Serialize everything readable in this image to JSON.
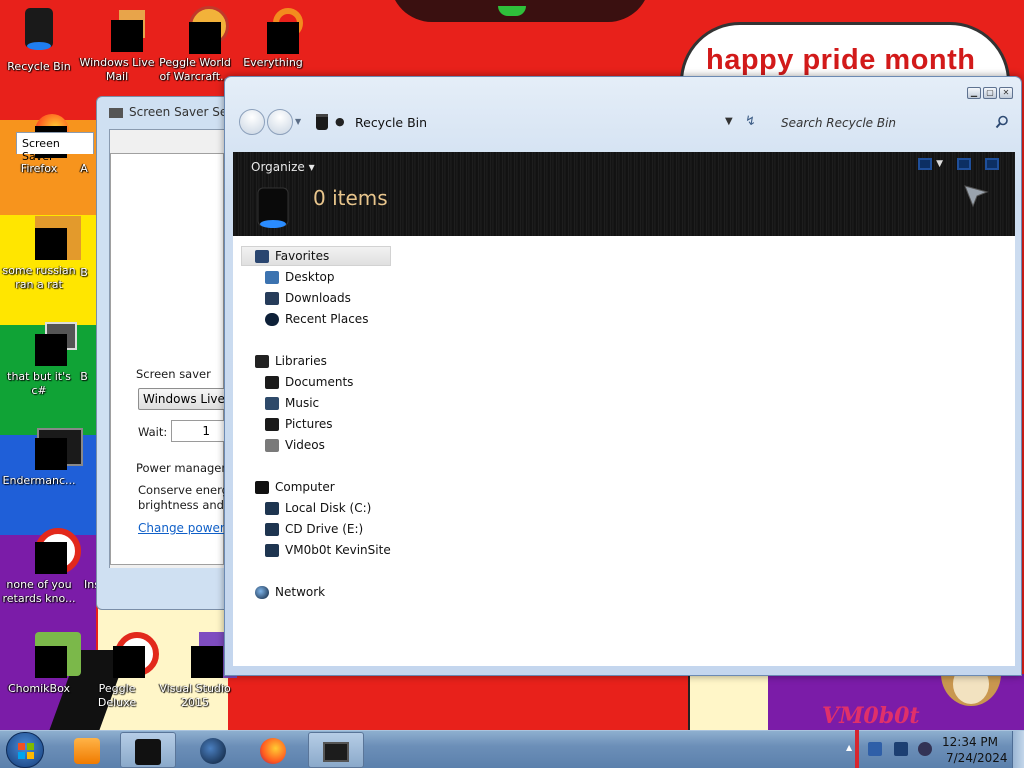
{
  "wallpaper": {
    "banner_text": "happy pride month",
    "logo_text": "VM0b0t"
  },
  "desktop_icons": [
    {
      "label": "Recycle Bin",
      "icon": "recycle-bin-icon"
    },
    {
      "label": "Windows Live Mail",
      "icon": "mail-icon"
    },
    {
      "label": "Peggle World of Warcraft...",
      "icon": "peggle-icon"
    },
    {
      "label": "Everything",
      "icon": "everything-icon"
    },
    {
      "label": "Firefox",
      "icon": "firefox-icon"
    },
    {
      "label": "some russian ran a rat",
      "icon": "app-icon"
    },
    {
      "label": "that but it's c#",
      "icon": "app-icon"
    },
    {
      "label": "Endermanc...",
      "icon": "app-icon"
    },
    {
      "label": "none of you retards kno...",
      "icon": "app-icon"
    },
    {
      "label": "ChomikBox",
      "icon": "chomikbox-icon"
    },
    {
      "label": "Peggle Deluxe",
      "icon": "peggle-icon"
    },
    {
      "label": "Visual Studio 2015",
      "icon": "visual-studio-icon"
    }
  ],
  "partial_icon_letters": {
    "a": "A",
    "b1": "B",
    "b2": "B",
    "ins": "Ins"
  },
  "screensaver_window": {
    "title": "Screen Saver Settin",
    "tab_label": "Screen Saver",
    "group_label": "Screen saver",
    "selected_saver": "Windows Live P",
    "wait_label": "Wait:",
    "wait_value": "1",
    "power_group_label": "Power managem",
    "power_text_line1": "Conserve energy",
    "power_text_line2": "brightness and o",
    "power_link": "Change power s"
  },
  "explorer": {
    "address_location": "Recycle Bin",
    "search_placeholder": "Search Recycle Bin",
    "organize_label": "Organize",
    "items_count": "0 items",
    "nav_tree": {
      "favorites": {
        "label": "Favorites",
        "items": [
          "Desktop",
          "Downloads",
          "Recent Places"
        ]
      },
      "libraries": {
        "label": "Libraries",
        "items": [
          "Documents",
          "Music",
          "Pictures",
          "Videos"
        ]
      },
      "computer": {
        "label": "Computer",
        "items": [
          "Local Disk (C:)",
          "CD Drive (E:)",
          "VM0b0t KevinSite"
        ]
      },
      "network": {
        "label": "Network"
      }
    }
  },
  "taskbar": {
    "pinned": [
      "media-player-icon",
      "explorer-icon",
      "network-globe-icon",
      "firefox-icon",
      "screensaver-icon"
    ],
    "clock_time": "12:34 PM",
    "clock_date": "7/24/2024"
  },
  "colors": {
    "accent_items_count": "#e8c58c",
    "banner_red": "#d21a1a",
    "link_blue": "#1060c8"
  }
}
